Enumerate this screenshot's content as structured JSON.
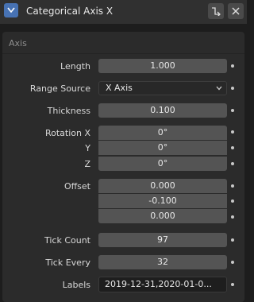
{
  "header": {
    "title": "Categorical Axis X",
    "collapse_icon": "chevron-down-icon",
    "link_icon": "node-link-icon",
    "close_icon": "close-icon",
    "accent": "#4772b3"
  },
  "section": {
    "label": "Axis"
  },
  "fields": {
    "length": {
      "label": "Length",
      "value": "1.000"
    },
    "range_source": {
      "label": "Range Source",
      "value": "X Axis"
    },
    "thickness": {
      "label": "Thickness",
      "value": "0.100"
    },
    "rotation_x": {
      "label": "Rotation X",
      "value": "0°"
    },
    "rotation_y": {
      "label": "Y",
      "value": "0°"
    },
    "rotation_z": {
      "label": "Z",
      "value": "0°"
    },
    "offset": {
      "label": "Offset",
      "values": [
        "0.000",
        "-0.100",
        "0.000"
      ]
    },
    "tick_count": {
      "label": "Tick Count",
      "value": "97"
    },
    "tick_every": {
      "label": "Tick Every",
      "value": "32"
    },
    "labels": {
      "label": "Labels",
      "value": "2019-12-31,2020-01-0..."
    }
  }
}
